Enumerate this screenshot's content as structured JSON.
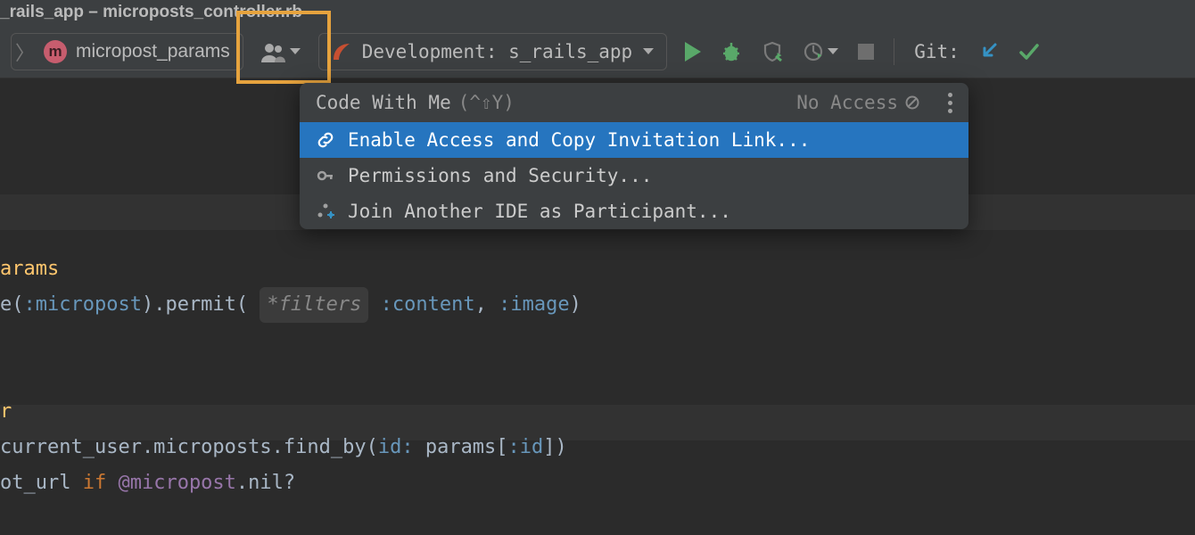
{
  "titlebar": "_rails_app – microposts_controller.rb",
  "toolbar": {
    "breadcrumb_label": "micropost_params",
    "run_config_label": "Development: s_rails_app",
    "git_label": "Git:"
  },
  "popup": {
    "title": "Code With Me",
    "shortcut": "(^⇧Y)",
    "access_label": "No Access",
    "items": [
      {
        "label": "Enable Access and Copy Invitation Link..."
      },
      {
        "label": "Permissions and Security..."
      },
      {
        "label": "Join Another IDE as Participant..."
      }
    ]
  },
  "code": {
    "l1": "arams",
    "l2a": "e(",
    "l2b": ":micropost",
    "l2c": ").permit(",
    "l2_filters": "*filters",
    "l2d": ":content",
    "l2e": ", ",
    "l2f": ":image",
    "l2g": ")",
    "l5": "r",
    "l6a": "current_user.microposts.find_by(",
    "l6b": "id: ",
    "l6c": "params[",
    "l6d": ":id",
    "l6e": "])",
    "l7a": "ot_url",
    "l7b": " if ",
    "l7c": "@micropost",
    "l7d": ".nil?"
  }
}
